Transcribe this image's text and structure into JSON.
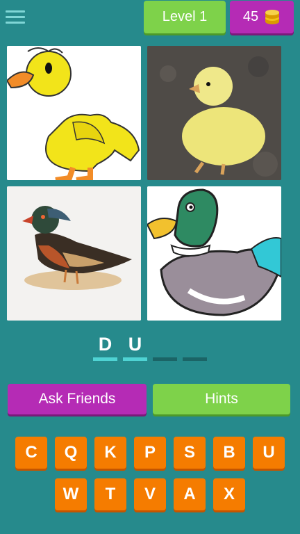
{
  "header": {
    "menu_icon": "hamburger-menu-icon",
    "level_label": "Level 1",
    "coins_value": "45",
    "coin_icon": "coin-stack-icon"
  },
  "tiles": [
    {
      "name": "cartoon-duckling-image"
    },
    {
      "name": "photo-duckling-image"
    },
    {
      "name": "wood-duck-illustration-image"
    },
    {
      "name": "mallard-cartoon-image"
    }
  ],
  "answer": {
    "letters": [
      "D",
      "U",
      "",
      ""
    ]
  },
  "actions": {
    "ask_friends_label": "Ask Friends",
    "hints_label": "Hints"
  },
  "keyboard": {
    "row1": [
      "C",
      "Q",
      "K",
      "P",
      "S",
      "B",
      "U"
    ],
    "row2": [
      "W",
      "T",
      "V",
      "A",
      "X"
    ]
  },
  "colors": {
    "background": "#268a8c",
    "green": "#7ed24a",
    "purple": "#b52bb5",
    "orange": "#f57c00",
    "slot_active": "#4fd3d3",
    "slot_empty": "#1b6466"
  }
}
